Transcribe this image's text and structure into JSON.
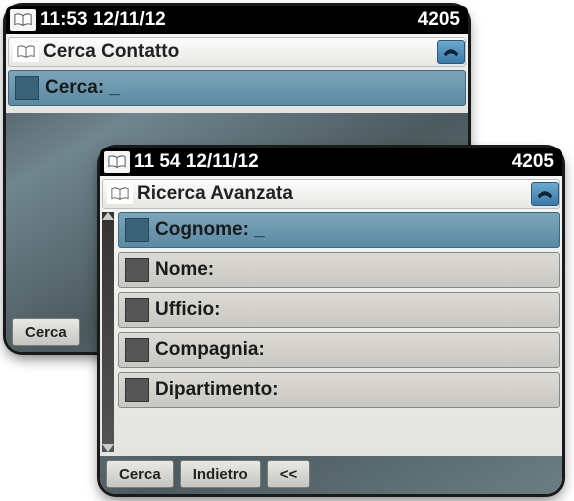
{
  "screen1": {
    "time": "11:53 12/11/12",
    "ext": "4205",
    "title": "Cerca Contatto",
    "search_label": "Cerca: _",
    "toolbar": {
      "search": "Cerca"
    }
  },
  "screen2": {
    "time": "11 54 12/11/12",
    "ext": "4205",
    "title": "Ricerca Avanzata",
    "fields": {
      "cognome": "Cognome: _",
      "nome": "Nome:",
      "ufficio": "Ufficio:",
      "compagnia": "Compagnia:",
      "dipartimento": "Dipartimento:"
    },
    "toolbar": {
      "search": "Cerca",
      "back": "Indietro",
      "prev": "<<"
    }
  }
}
